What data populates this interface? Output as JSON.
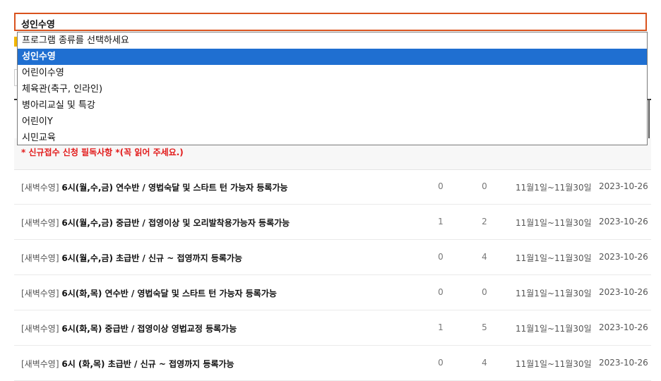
{
  "program_select": {
    "value": "성인수영",
    "options": [
      {
        "label": "프로그램 종류를 선택하세요",
        "selected": false
      },
      {
        "label": "성인수영",
        "selected": true
      },
      {
        "label": "어린이수영",
        "selected": false
      },
      {
        "label": "체육관(축구, 인라인)",
        "selected": false
      },
      {
        "label": "병아리교실 및 특강",
        "selected": false
      },
      {
        "label": "어린이Y",
        "selected": false
      },
      {
        "label": "시민교육",
        "selected": false
      }
    ]
  },
  "notice": {
    "text": "* 신규접수 신청 필독사항 *(꼭 읽어 주세요.)",
    "color": "#e21b1b"
  },
  "rows": [
    {
      "prefix": "[새벽수영]",
      "title": "6시(월,수,금) 연수반 / 영법숙달 및 스타트 턴 가능자 등록가능",
      "n1": "0",
      "n2": "0",
      "period": "11월1일~11월30일",
      "date": "2023-10-26"
    },
    {
      "prefix": "[새벽수영]",
      "title": "6시(월,수,금) 중급반 / 접영이상 및 오리발착용가능자 등록가능",
      "n1": "1",
      "n2": "2",
      "period": "11월1일~11월30일",
      "date": "2023-10-26"
    },
    {
      "prefix": "[새벽수영]",
      "title": "6시(월,수,금) 초급반 / 신규 ~ 접영까지 등록가능",
      "n1": "0",
      "n2": "4",
      "period": "11월1일~11월30일",
      "date": "2023-10-26"
    },
    {
      "prefix": "[새벽수영]",
      "title": "6시(화,목) 연수반 / 영법숙달 및 스타트 턴 가능자 등록가능",
      "n1": "0",
      "n2": "0",
      "period": "11월1일~11월30일",
      "date": "2023-10-26"
    },
    {
      "prefix": "[새벽수영]",
      "title": "6시(화,목) 중급반 / 접영이상 영법교정 등록가능",
      "n1": "1",
      "n2": "5",
      "period": "11월1일~11월30일",
      "date": "2023-10-26"
    },
    {
      "prefix": "[새벽수영]",
      "title": "6시 (화,목) 초급반 / 신규 ~ 접영까지 등록가능",
      "n1": "0",
      "n2": "4",
      "period": "11월1일~11월30일",
      "date": "2023-10-26"
    }
  ],
  "colors": {
    "select_border": "#d9531e",
    "option_selected_bg": "#1f6fd1"
  }
}
